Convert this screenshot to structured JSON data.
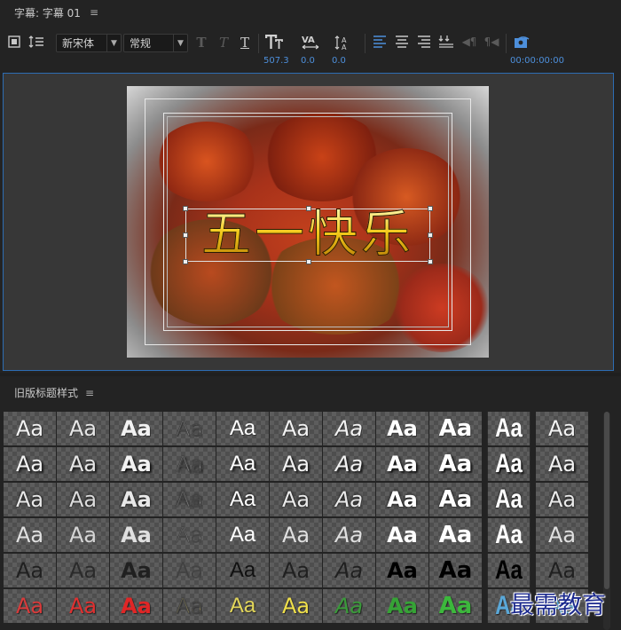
{
  "panel": {
    "title": "字幕: 字幕 01",
    "menu_glyph": "≡"
  },
  "toolbar": {
    "font_family": "新宋体",
    "font_style": "常规",
    "font_size": "507.3",
    "kerning": "0.0",
    "leading": "0.0",
    "timecode": "00:00:00:00",
    "bold_glyph": "T",
    "italic_glyph": "T",
    "underline_glyph": "T",
    "accent_color": "#4d8fdb"
  },
  "canvas": {
    "title_text": "五一快乐"
  },
  "styles": {
    "title": "旧版标题样式",
    "menu_glyph": "≡",
    "sample": "Aa"
  },
  "watermark": "最需教育"
}
